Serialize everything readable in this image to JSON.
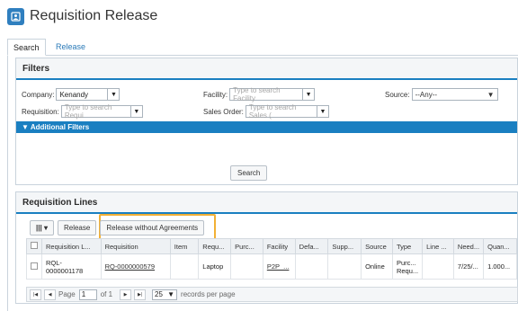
{
  "page_title": "Requisition Release",
  "tabs": [
    {
      "label": "Search",
      "active": true
    },
    {
      "label": "Release",
      "active": false
    }
  ],
  "filters": {
    "heading": "Filters",
    "company_label": "Company:",
    "company_value": "Kenandy",
    "facility_label": "Facility:",
    "facility_placeholder": "Type to search Facility",
    "source_label": "Source:",
    "source_value": "--Any--",
    "requisition_label": "Requisition:",
    "requisition_placeholder": "Type to search Requi",
    "sales_order_label": "Sales Order:",
    "sales_order_placeholder": "Type to search Sales (",
    "additional_filters": "Additional Filters",
    "search_button": "Search"
  },
  "lines": {
    "heading": "Requisition Lines",
    "columns_button": "▾",
    "release_button": "Release",
    "release_wo_button": "Release without Agreements",
    "columns": [
      "Requisition L...",
      "Requisition",
      "Item",
      "Requ...",
      "Purc...",
      "Facility",
      "Defa...",
      "Supp...",
      "Source",
      "Type",
      "Line ...",
      "Need...",
      "Quan..."
    ],
    "rows": [
      {
        "line_a": "RQL-",
        "line_b": "0000001178",
        "requisition": "RQ-0000000579",
        "item": "",
        "requested": "Laptop",
        "purchase": "",
        "facility": "P2P_...",
        "default": "",
        "supplier": "",
        "source": "Online",
        "type_a": "Purc...",
        "type_b": "Requ...",
        "line_type": "",
        "need": "7/25/...",
        "quantity": "1.000..."
      }
    ],
    "pager": {
      "page_label": "Page",
      "page_value": "1",
      "of_label": "of 1",
      "page_size": "25",
      "per_page_label": "records per page"
    }
  },
  "colors": {
    "accent": "#1a7fc1",
    "highlight": "#f2b035",
    "tab_link": "#2a7ab8"
  }
}
